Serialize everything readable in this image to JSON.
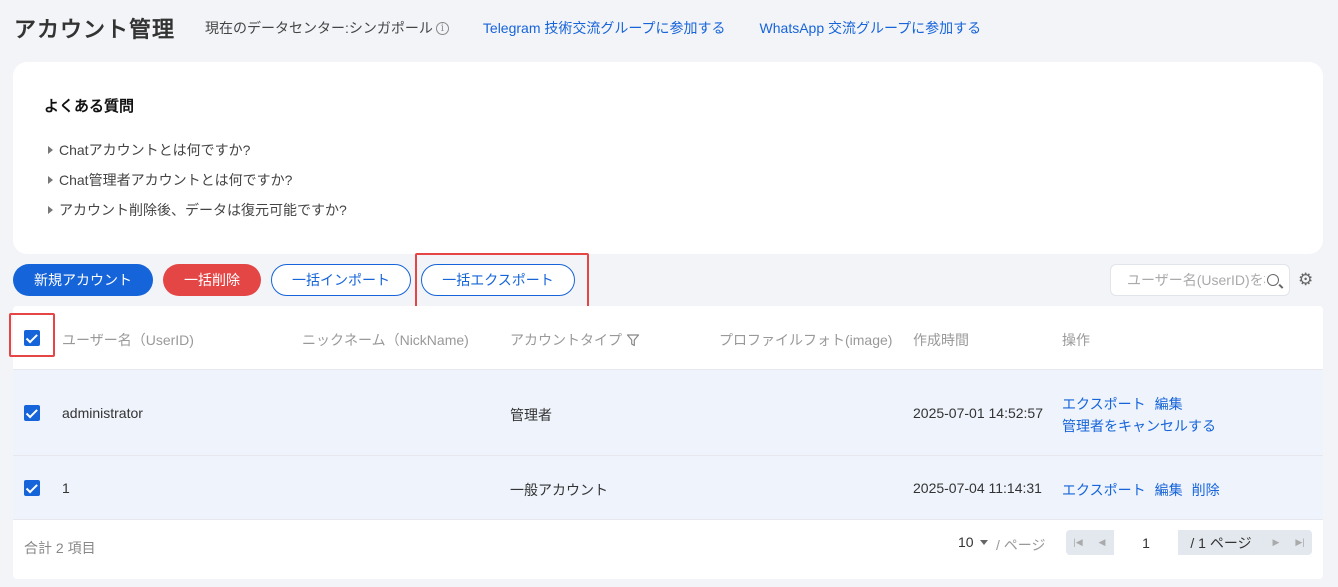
{
  "header": {
    "title": "アカウント管理",
    "datacenter": "現在のデータセンター:シンガポール",
    "telegram_link": "Telegram 技術交流グループに参加する",
    "whatsapp_link": "WhatsApp 交流グループに参加する"
  },
  "faq": {
    "title": "よくある質問",
    "items": [
      "Chatアカウントとは何ですか?",
      "Chat管理者アカウントとは何ですか?",
      "アカウント削除後、データは復元可能ですか?"
    ]
  },
  "toolbar": {
    "new_account": "新規アカウント",
    "bulk_delete": "一括削除",
    "bulk_import": "一括インポート",
    "bulk_export": "一括エクスポート",
    "search_placeholder": "ユーザー名(UserID)を検索"
  },
  "table": {
    "columns": [
      "ユーザー名（UserID)",
      "ニックネーム（NickName)",
      "アカウントタイプ",
      "プロファイルフォト(image)",
      "作成時間",
      "操作"
    ],
    "select_all_checked": true,
    "rows": [
      {
        "checked": true,
        "user_id": "administrator",
        "nickname": "",
        "type": "管理者",
        "image": "",
        "created": "2025-07-01 14:52:57",
        "ops": [
          "エクスポート",
          "編集"
        ],
        "ops2": "管理者をキャンセルする"
      },
      {
        "checked": true,
        "user_id": "1",
        "nickname": "",
        "type": "一般アカウント",
        "image": "",
        "created": "2025-07-04 11:14:31",
        "ops": [
          "エクスポート",
          "編集",
          "削除"
        ]
      }
    ]
  },
  "footer": {
    "total": "合計 2 項目",
    "page_size": "10",
    "per_page": "/ ページ",
    "current_page": "1",
    "total_pages": "/ 1 ページ"
  },
  "colors": {
    "accent": "#1664d9",
    "danger": "#e44646",
    "highlight_box": "#e54545",
    "row_selected_bg": "#eef3fc"
  }
}
